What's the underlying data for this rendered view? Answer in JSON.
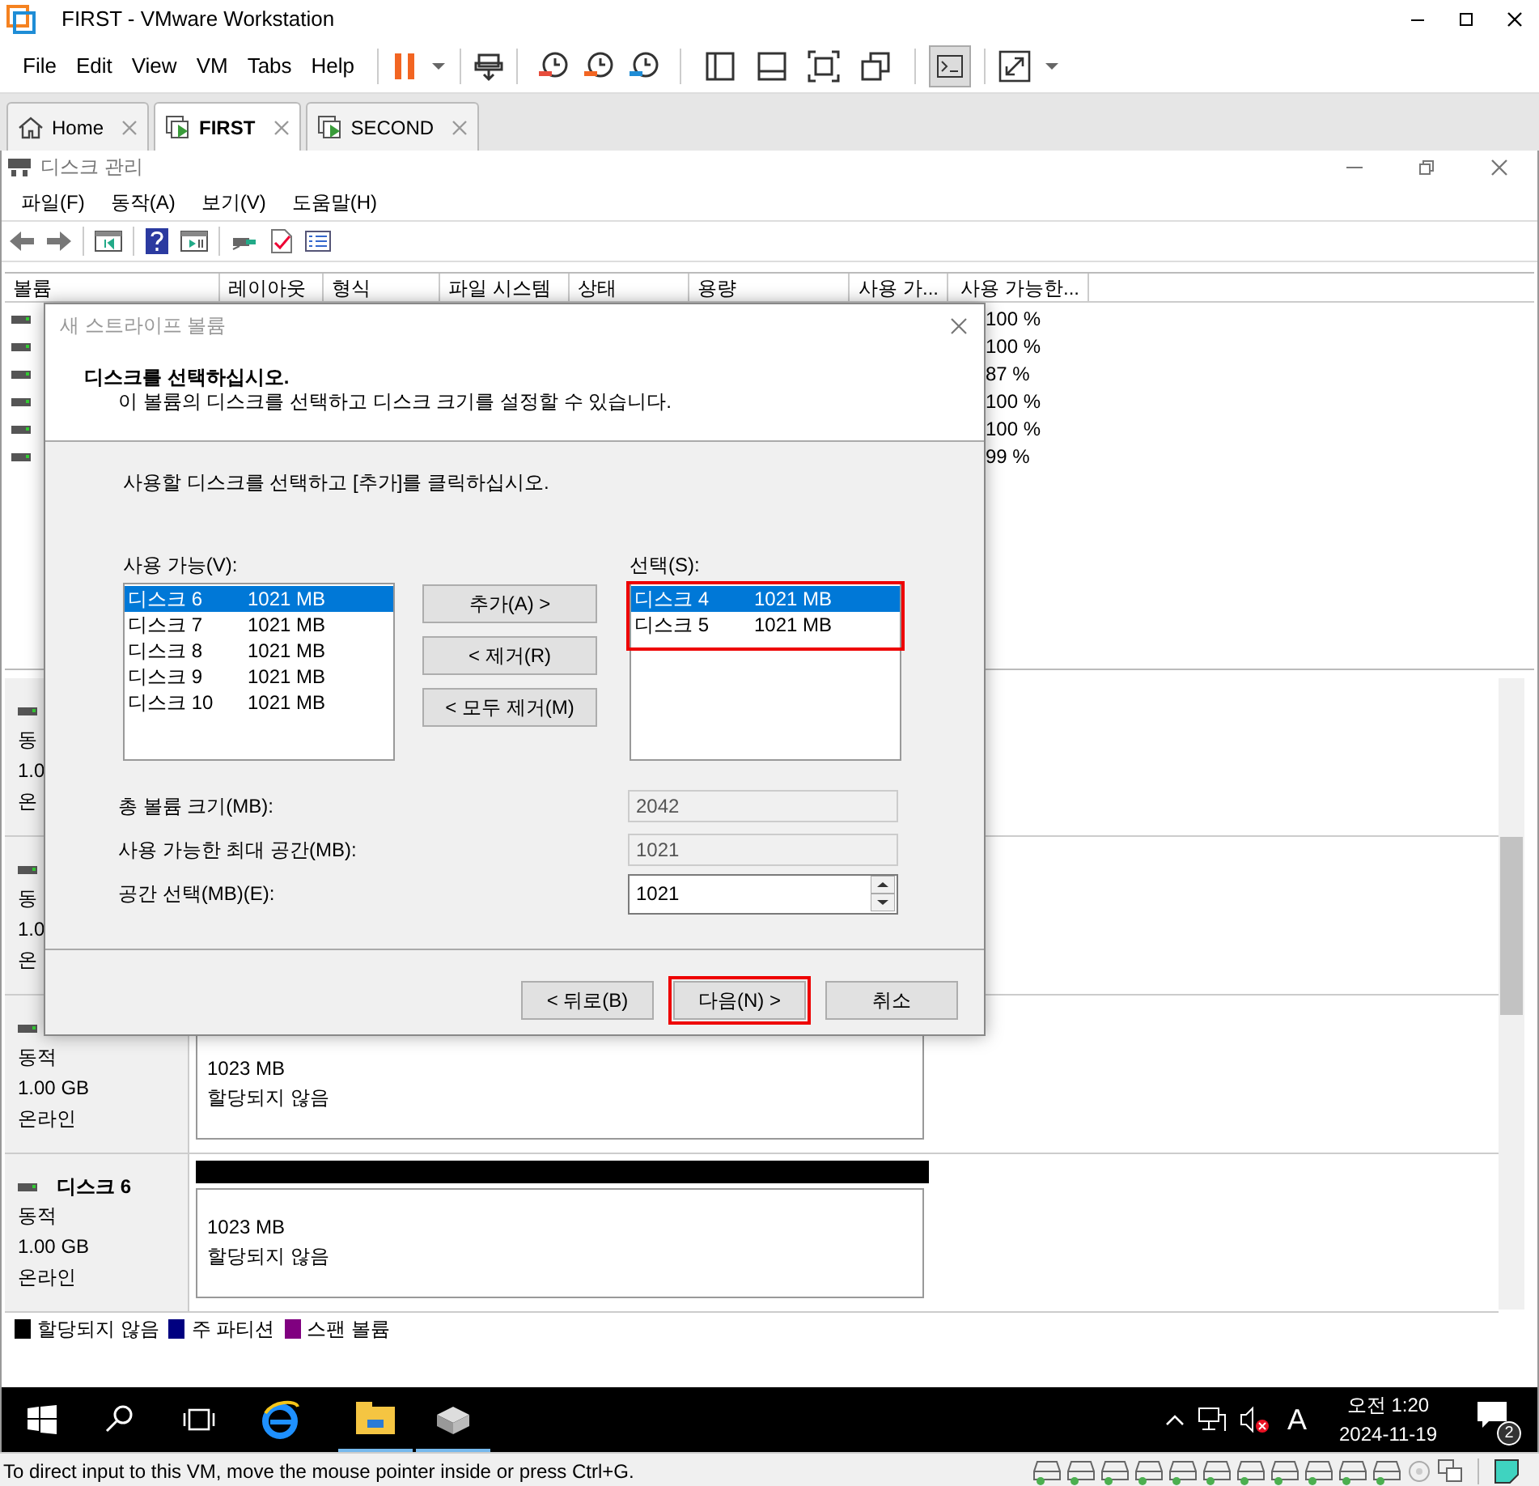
{
  "window": {
    "title": "FIRST - VMware Workstation"
  },
  "menu": [
    "File",
    "Edit",
    "View",
    "VM",
    "Tabs",
    "Help"
  ],
  "tabs": [
    {
      "label": "Home",
      "kind": "home",
      "selected": false
    },
    {
      "label": "FIRST",
      "kind": "vm",
      "selected": true
    },
    {
      "label": "SECOND",
      "kind": "vm",
      "selected": false
    }
  ],
  "disk_management": {
    "title": "디스크 관리",
    "menu": [
      "파일(F)",
      "동작(A)",
      "보기(V)",
      "도움말(H)"
    ],
    "volume_list": {
      "columns": [
        "볼륨",
        "레이아웃",
        "형식",
        "파일 시스템",
        "상태",
        "용량",
        "사용 가...",
        "사용 가능한..."
      ],
      "rows": [
        {
          "free_percent": "100 %"
        },
        {
          "free_percent": "100 %"
        },
        {
          "free_percent": "87 %"
        },
        {
          "free_percent": "100 %"
        },
        {
          "free_percent": "100 %"
        },
        {
          "free_percent": "99 %"
        }
      ]
    },
    "disks": [
      {
        "type": "동",
        "size": "1.0",
        "status": "온"
      },
      {
        "type": "동",
        "size": "1.0",
        "status": "온"
      },
      {
        "type": "동적",
        "size": "1.00 GB",
        "status": "온라인",
        "partition": {
          "size": "1023 MB",
          "status": "할당되지 않음"
        }
      },
      {
        "name": "디스크 6",
        "type": "동적",
        "size": "1.00 GB",
        "status": "온라인",
        "partition": {
          "size": "1023 MB",
          "status": "할당되지 않음"
        }
      }
    ],
    "legend": [
      {
        "label": "할당되지 않음",
        "color": "#000000"
      },
      {
        "label": "주 파티션",
        "color": "#000080"
      },
      {
        "label": "스팬 볼륨",
        "color": "#800080"
      }
    ]
  },
  "dialog": {
    "title": "새 스트라이프 볼륨",
    "heading": "디스크를 선택하십시오.",
    "subheading": "이 볼륨의 디스크를 선택하고 디스크 크기를 설정할 수 있습니다.",
    "instruction": "사용할 디스크를 선택하고 [추가]를 클릭하십시오.",
    "available": {
      "label": "사용 가능(V):",
      "highlighted": false,
      "items": [
        {
          "name": "디스크 6",
          "size": "1021 MB",
          "selected": true
        },
        {
          "name": "디스크 7",
          "size": "1021 MB",
          "selected": false
        },
        {
          "name": "디스크 8",
          "size": "1021 MB",
          "selected": false
        },
        {
          "name": "디스크 9",
          "size": "1021 MB",
          "selected": false
        },
        {
          "name": "디스크 10",
          "size": "1021 MB",
          "selected": false
        }
      ]
    },
    "chosen": {
      "label": "선택(S):",
      "highlighted": true,
      "items": [
        {
          "name": "디스크 4",
          "size": "1021 MB",
          "selected": true
        },
        {
          "name": "디스크 5",
          "size": "1021 MB",
          "selected": false
        }
      ]
    },
    "move_buttons": [
      "추가(A) >",
      "< 제거(R)",
      "< 모두 제거(M)"
    ],
    "fields": [
      {
        "label": "총 볼륨 크기(MB):",
        "value": "2042",
        "kind": "readonly"
      },
      {
        "label": "사용 가능한 최대 공간(MB):",
        "value": "1021",
        "kind": "readonly"
      },
      {
        "label": "공간 선택(MB)(E):",
        "value": "1021",
        "kind": "spinner"
      }
    ],
    "buttons": [
      {
        "label": "< 뒤로(B)",
        "highlighted": false
      },
      {
        "label": "다음(N) >",
        "highlighted": true
      },
      {
        "label": "취소",
        "highlighted": false
      }
    ]
  },
  "taskbar": {
    "input_indicator": "A",
    "time": "오전 1:20",
    "date": "2024-11-19",
    "notifications": "2"
  },
  "status_bar": {
    "text": "To direct input to this VM, move the mouse pointer inside or press Ctrl+G."
  }
}
